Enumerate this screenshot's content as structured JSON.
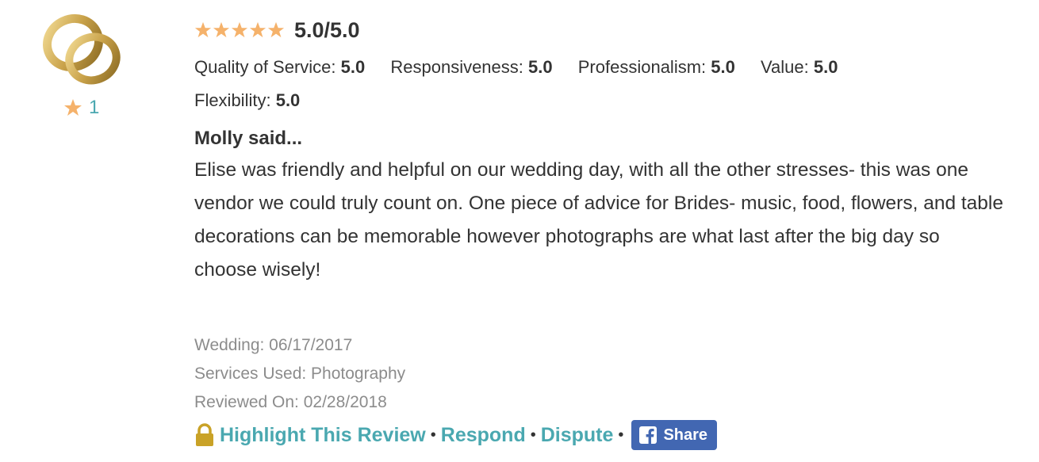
{
  "reviewer": {
    "avatar_icon": "wedding-rings-icon",
    "star_count": "1"
  },
  "rating": {
    "stars_filled": 5,
    "stars_total": 5,
    "overall": "5.0/5.0"
  },
  "metrics": [
    {
      "label": "Quality of Service:",
      "value": "5.0"
    },
    {
      "label": "Responsiveness:",
      "value": "5.0"
    },
    {
      "label": "Professionalism:",
      "value": "5.0"
    },
    {
      "label": "Value:",
      "value": "5.0"
    },
    {
      "label": "Flexibility:",
      "value": "5.0"
    }
  ],
  "review": {
    "author": "Molly said...",
    "text": "Elise was friendly and helpful on our wedding day, with all the other stresses- this was one vendor we could truly count on. One piece of advice for Brides- music, food, flowers, and table decorations can be memorable however photographs are what last after the big day so choose wisely!"
  },
  "meta": {
    "wedding": "Wedding: 06/17/2017",
    "services": "Services Used: Photography",
    "reviewed": "Reviewed On: 02/28/2018"
  },
  "actions": {
    "highlight": "Highlight This Review",
    "respond": "Respond",
    "dispute": "Dispute",
    "share": "Share",
    "separator": "•"
  },
  "colors": {
    "star": "#f5b26b",
    "link": "#4aa8b0",
    "facebook": "#4267b2",
    "meta_text": "#8c8c8c",
    "lock": "#c9a227"
  }
}
